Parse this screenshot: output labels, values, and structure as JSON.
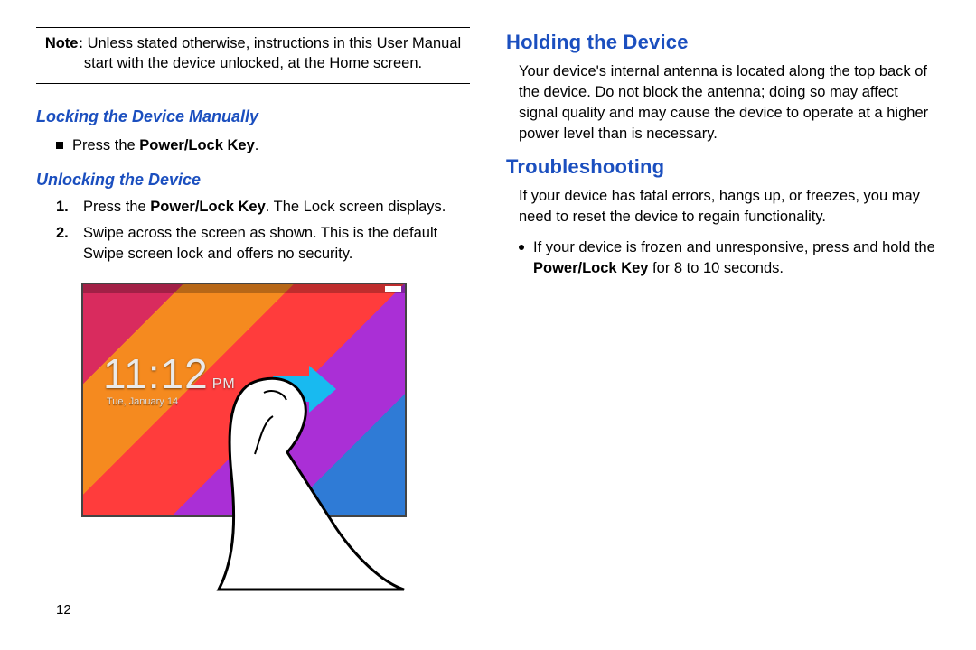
{
  "page_number": "12",
  "left": {
    "note_label": "Note:",
    "note_text": " Unless stated otherwise, instructions in this User Manual start with the device unlocked, at the Home screen.",
    "sub1": "Locking the Device Manually",
    "lock_bullet_pre": "Press the ",
    "lock_bullet_strong": "Power/Lock Key",
    "lock_bullet_post": ".",
    "sub2": "Unlocking the Device",
    "step1_num": "1.",
    "step1_pre": "Press the ",
    "step1_strong": "Power/Lock Key",
    "step1_post": ". The Lock screen displays.",
    "step2_num": "2.",
    "step2_text": "Swipe across the screen as shown. This is the default Swipe screen lock and offers no security.",
    "illustration": {
      "time": "11:12",
      "ampm": "PM",
      "date": "Tue, January 14"
    }
  },
  "right": {
    "h1": "Holding the Device",
    "p1": "Your device's internal antenna is located along the top back of the device. Do not block the antenna; doing so may affect signal quality and may cause the device to operate at a higher power level than is necessary.",
    "h2": "Troubleshooting",
    "p2": "If your device has fatal errors, hangs up, or freezes, you may need to reset the device to regain functionality.",
    "bullet_pre": "If your device is frozen and unresponsive, press and hold the ",
    "bullet_strong": "Power/Lock Key",
    "bullet_post": " for 8 to 10 seconds."
  }
}
